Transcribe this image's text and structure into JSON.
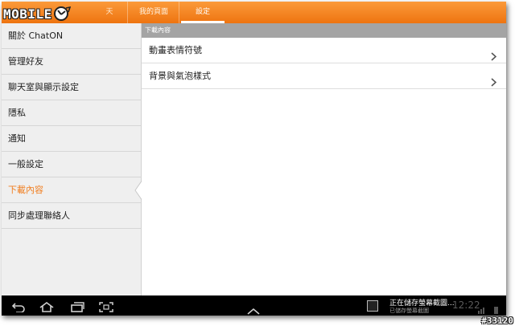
{
  "logo": {
    "text": "MOBILE"
  },
  "tabs": [
    {
      "label": "天"
    },
    {
      "label": "我的頁面"
    },
    {
      "label": "設定"
    }
  ],
  "menu": {
    "items": [
      {
        "label": "關於 ChatON"
      },
      {
        "label": "管理好友"
      },
      {
        "label": "聊天室與顯示設定"
      },
      {
        "label": "隱私"
      },
      {
        "label": "通知"
      },
      {
        "label": "一般設定"
      },
      {
        "label": "下載內容",
        "active": true
      },
      {
        "label": "同步處理聯絡人"
      }
    ]
  },
  "panel": {
    "header": "下載內容",
    "rows": [
      {
        "label": "動畫表情符號"
      },
      {
        "label": "背景與氣泡樣式"
      }
    ]
  },
  "notification": {
    "title": "正在儲存螢幕截圖...",
    "subtitle": "已儲存螢幕截圖",
    "time": "12:22"
  },
  "tag": "#33120",
  "colors": {
    "accent": "#f07e20",
    "topbar": "#f58a2a",
    "header": "#a4a4a4"
  }
}
